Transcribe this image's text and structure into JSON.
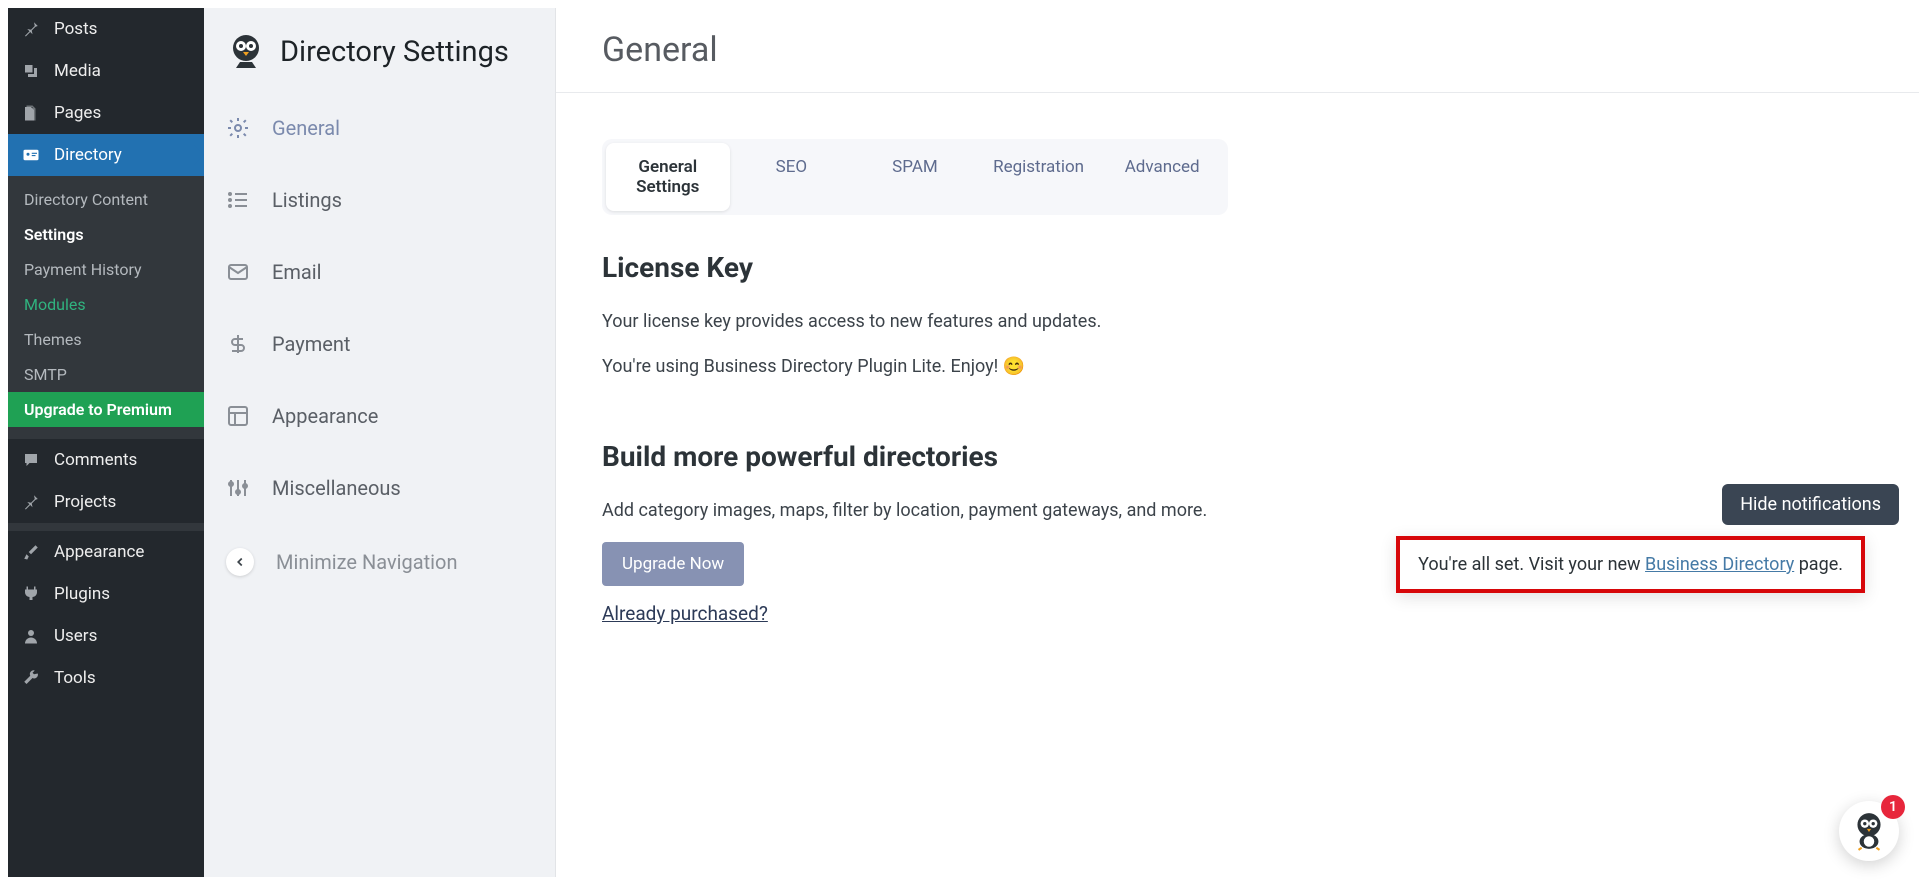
{
  "wp_sidebar": {
    "items": [
      {
        "label": "Posts",
        "icon": "pin"
      },
      {
        "label": "Media",
        "icon": "media"
      },
      {
        "label": "Pages",
        "icon": "pages"
      },
      {
        "label": "Directory",
        "icon": "id-card",
        "active": true
      }
    ],
    "submenu": [
      {
        "label": "Directory Content"
      },
      {
        "label": "Settings",
        "bold": true
      },
      {
        "label": "Payment History"
      },
      {
        "label": "Modules",
        "green": true
      },
      {
        "label": "Themes"
      },
      {
        "label": "SMTP"
      }
    ],
    "upgrade": "Upgrade to Premium",
    "items2": [
      {
        "label": "Comments",
        "icon": "comment"
      },
      {
        "label": "Projects",
        "icon": "pin"
      }
    ],
    "items3": [
      {
        "label": "Appearance",
        "icon": "brush"
      },
      {
        "label": "Plugins",
        "icon": "plug"
      },
      {
        "label": "Users",
        "icon": "user"
      },
      {
        "label": "Tools",
        "icon": "wrench"
      }
    ]
  },
  "settings_sidebar": {
    "title": "Directory Settings",
    "items": [
      {
        "label": "General",
        "active": true
      },
      {
        "label": "Listings"
      },
      {
        "label": "Email"
      },
      {
        "label": "Payment"
      },
      {
        "label": "Appearance"
      },
      {
        "label": "Miscellaneous"
      }
    ],
    "minimize": "Minimize Navigation"
  },
  "main": {
    "title": "General",
    "tabs": [
      {
        "label": "General Settings",
        "active": true
      },
      {
        "label": "SEO"
      },
      {
        "label": "SPAM"
      },
      {
        "label": "Registration"
      },
      {
        "label": "Advanced"
      }
    ],
    "license": {
      "heading": "License Key",
      "desc": "Your license key provides access to new features and updates.",
      "using": "You're using Business Directory Plugin Lite. Enjoy! 😊"
    },
    "build": {
      "heading": "Build more powerful directories",
      "desc": "Add category images, maps, filter by location, payment gateways, and more.",
      "upgrade_btn": "Upgrade Now",
      "purchased": "Already purchased?"
    }
  },
  "hide_notifications": "Hide notifications",
  "notification": {
    "prefix": "You're all set. Visit your new ",
    "link": "Business Directory",
    "suffix": " page."
  },
  "float_badge": "1"
}
